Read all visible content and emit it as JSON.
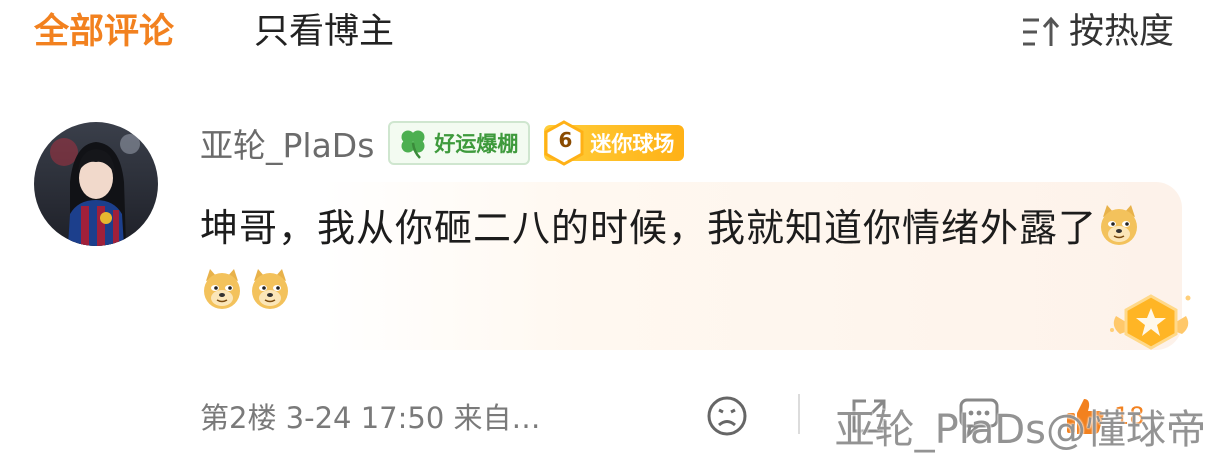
{
  "tabs": {
    "all_label": "全部评论",
    "author_only_label": "只看博主"
  },
  "sort": {
    "label": "按热度",
    "icon": "sort-icon"
  },
  "comment": {
    "username": "亚轮_PlaDs",
    "badges": {
      "lucky_label": "好运爆棚",
      "lucky_icon": "clover-icon",
      "level_number": "6",
      "level_label": "迷你球场"
    },
    "text": "坤哥，我从你砸二八的时候，我就知道你情绪外露了",
    "emoji_icons": [
      "doge-emoji",
      "doge-emoji",
      "doge-emoji"
    ],
    "meta": "第2楼 3-24 17:50 来自…",
    "like_count": "18"
  },
  "watermark": "亚轮_PlaDs@懂球帝",
  "colors": {
    "accent": "#f2811f",
    "badge_green": "#3e9a3c",
    "badge_gold": "#ffb116"
  }
}
